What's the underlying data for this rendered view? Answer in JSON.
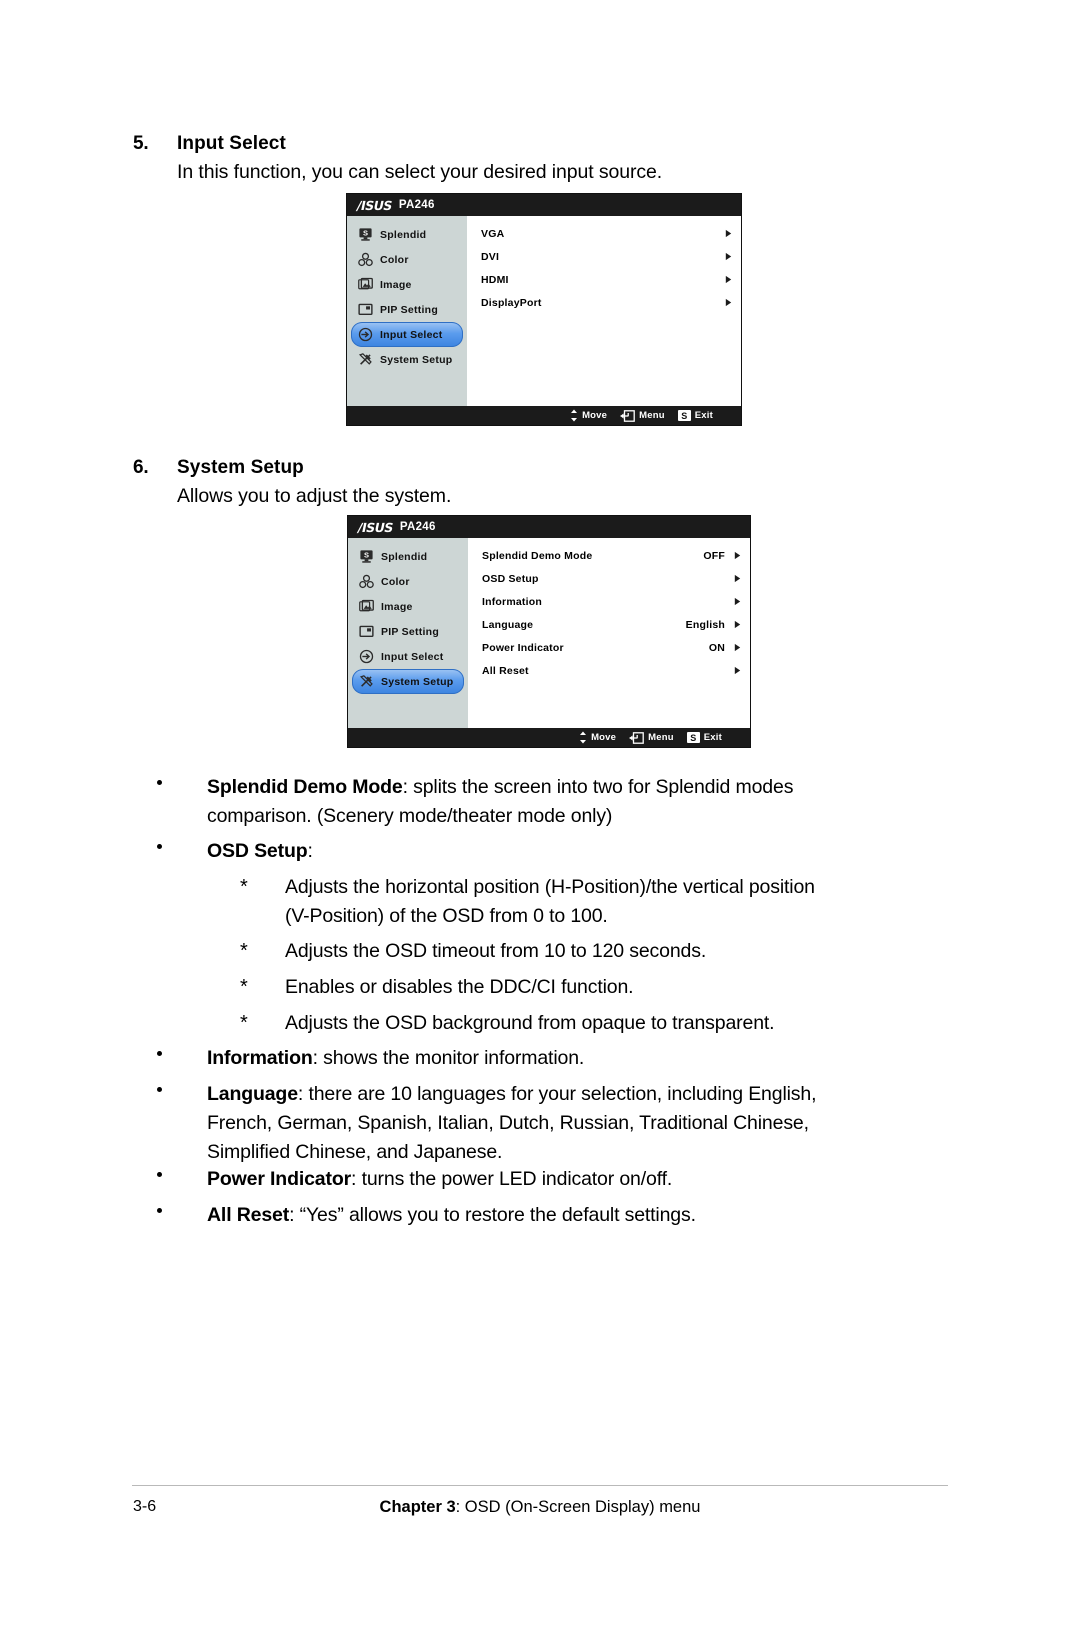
{
  "sections": [
    {
      "number": "5.",
      "title": "Input Select",
      "description": "In this function, you can select your desired input source."
    },
    {
      "number": "6.",
      "title": "System Setup",
      "description": "Allows you to adjust the system."
    }
  ],
  "osd_input_select": {
    "brand": "/ISUS",
    "model": "PA246",
    "nav_items": [
      {
        "label": "Splendid",
        "icon": "splendid-icon",
        "active": false
      },
      {
        "label": "Color",
        "icon": "color-palette-icon",
        "active": false
      },
      {
        "label": "Image",
        "icon": "image-icon",
        "active": false
      },
      {
        "label": "PIP Setting",
        "icon": "pip-icon",
        "active": false
      },
      {
        "label": "Input Select",
        "icon": "input-select-icon",
        "active": true
      },
      {
        "label": "System Setup",
        "icon": "tools-icon",
        "active": false
      }
    ],
    "options": [
      {
        "label": "VGA",
        "value": "",
        "arrow": "chevron-right-icon"
      },
      {
        "label": "DVI",
        "value": "",
        "arrow": "chevron-right-icon"
      },
      {
        "label": "HDMI",
        "value": "",
        "arrow": "chevron-right-icon"
      },
      {
        "label": "DisplayPort",
        "value": "",
        "arrow": "chevron-right-icon"
      }
    ],
    "footer": [
      {
        "label": "Move",
        "icon": "up-down-arrows-icon"
      },
      {
        "label": "Menu",
        "icon": "enter-key-icon"
      },
      {
        "label": "Exit",
        "icon": "s-badge-icon",
        "badge": "S"
      }
    ]
  },
  "osd_system_setup": {
    "brand": "/ISUS",
    "model": "PA246",
    "nav_items": [
      {
        "label": "Splendid",
        "icon": "splendid-icon",
        "active": false
      },
      {
        "label": "Color",
        "icon": "color-palette-icon",
        "active": false
      },
      {
        "label": "Image",
        "icon": "image-icon",
        "active": false
      },
      {
        "label": "PIP Setting",
        "icon": "pip-icon",
        "active": false
      },
      {
        "label": "Input Select",
        "icon": "input-select-icon",
        "active": false
      },
      {
        "label": "System Setup",
        "icon": "tools-icon",
        "active": true
      }
    ],
    "options": [
      {
        "label": "Splendid Demo Mode",
        "value": "OFF",
        "arrow": "chevron-right-icon"
      },
      {
        "label": "OSD Setup",
        "value": "",
        "arrow": "chevron-right-icon"
      },
      {
        "label": "Information",
        "value": "",
        "arrow": "chevron-right-icon"
      },
      {
        "label": "Language",
        "value": "English",
        "arrow": "chevron-right-icon"
      },
      {
        "label": "Power Indicator",
        "value": "ON",
        "arrow": "chevron-right-icon"
      },
      {
        "label": "All Reset",
        "value": "",
        "arrow": "chevron-right-icon"
      }
    ],
    "footer": [
      {
        "label": "Move",
        "icon": "up-down-arrows-icon"
      },
      {
        "label": "Menu",
        "icon": "enter-key-icon"
      },
      {
        "label": "Exit",
        "icon": "s-badge-icon",
        "badge": "S"
      }
    ]
  },
  "bullets": {
    "splendid_demo_bold": "Splendid Demo Mode",
    "splendid_demo_rest": ": splits the screen into two for Splendid modes",
    "splendid_demo_line2": "comparison. (Scenery mode/theater mode only)",
    "osd_setup_bold": "OSD Setup",
    "osd_setup_rest": ":",
    "sub_items": [
      {
        "line1": "Adjusts the horizontal position (H-Position)/the vertical position",
        "line2": "(V-Position) of the OSD from 0 to 100."
      },
      {
        "line1": "Adjusts the OSD timeout from 10 to 120 seconds.",
        "line2": ""
      },
      {
        "line1": "Enables or disables the DDC/CI function.",
        "line2": ""
      },
      {
        "line1": "Adjusts the OSD background from opaque to transparent.",
        "line2": ""
      }
    ],
    "information_bold": "Information",
    "information_rest": ": shows the monitor information.",
    "language_bold": "Language",
    "language_rest": ": there are 10 languages for your selection, including English,",
    "language_line2": "French, German, Spanish, Italian, Dutch, Russian, Traditional Chinese,",
    "language_line3": "Simplified Chinese, and Japanese.",
    "power_bold": "Power Indicator",
    "power_rest": ": turns the power LED indicator on/off.",
    "allreset_bold": "All Reset",
    "allreset_rest": ": “Yes” allows you to restore the default settings.",
    "star": "*"
  },
  "footer": {
    "page_number": "3-6",
    "chapter_bold": "Chapter 3",
    "chapter_rest": ": OSD (On-Screen Display) menu"
  },
  "colors": {
    "osd_title_bar": "#1b1b1b",
    "osd_sidebar": "#cdd6d5",
    "osd_highlight": "#5b9ced",
    "footer_rule": "#b9b9b9"
  }
}
